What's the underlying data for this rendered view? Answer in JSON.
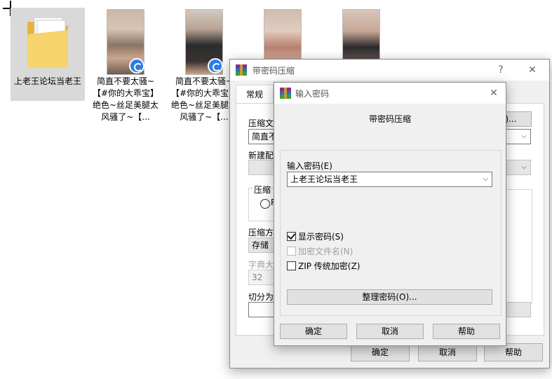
{
  "desktop": {
    "items": [
      {
        "label": "上老王论坛当老王",
        "kind": "folder"
      },
      {
        "label": "简直不要太骚~【#你的大乖宝】 绝色~丝足美腿太风骚了~【...",
        "kind": "video"
      },
      {
        "label": "简直不要太骚~【#你的大乖宝】 绝色~丝足美腿太风骚了~【...",
        "kind": "video"
      },
      {
        "label": "",
        "kind": "video"
      },
      {
        "label": "",
        "kind": "video"
      }
    ]
  },
  "outer_dialog": {
    "title": "带密码压缩",
    "help_symbol": "?",
    "close_symbol": "✕",
    "tab_general": "常规",
    "label_archive_name": "压缩文",
    "archive_name_value": "简直不",
    "browse_button": "(B)...",
    "label_update_mode": "新建配",
    "label_format": "压缩",
    "radio_partial": "R",
    "label_method": "压缩方",
    "method_value": "存储",
    "label_dict": "字典大",
    "dict_value": "32",
    "label_split": "切分为",
    "ok_button": "确定",
    "cancel_button": "取消",
    "help_button": "帮助"
  },
  "password_dialog": {
    "title": "输入密码",
    "close_symbol": "✕",
    "heading": "带密码压缩",
    "label_password": "输入密码(E)",
    "password_value": "上老王论坛当老王",
    "show_password_label": "显示密码(S)",
    "show_password_checked": true,
    "encrypt_names_label": "加密文件名(N)",
    "encrypt_names_checked": false,
    "zip_legacy_label": "ZIP 传统加密(Z)",
    "zip_legacy_checked": false,
    "organize_button": "整理密码(O)...",
    "ok_button": "确定",
    "cancel_button": "取消",
    "help_button": "帮助"
  },
  "colors": {
    "folder": "#f2c94c",
    "badge": "#2b7de9",
    "window_bg": "#f0f0f0"
  }
}
